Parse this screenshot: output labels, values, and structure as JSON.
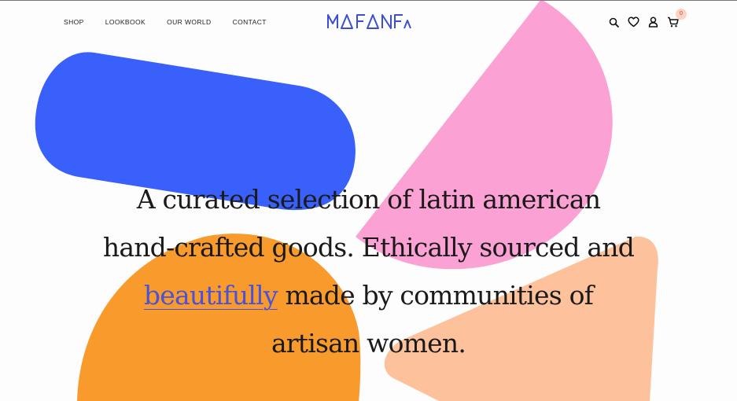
{
  "nav": {
    "items": [
      {
        "label": "SHOP"
      },
      {
        "label": "LOOKBOOK"
      },
      {
        "label": "OUR WORLD"
      },
      {
        "label": "CONTACT"
      }
    ]
  },
  "brand": {
    "name": "MAFANFA",
    "color": "#3b4fd6"
  },
  "header_icons": {
    "search": "search-icon",
    "wishlist": "heart-icon",
    "account": "user-icon",
    "cart": "cart-icon",
    "cart_count": "0"
  },
  "hero": {
    "text_before": "A curated selection of latin american hand-crafted goods. Ethically sourced and ",
    "link_text": "beautifully",
    "text_after": " made by communities of artisan women."
  },
  "colors": {
    "blue_shape": "#3a60fb",
    "pink_shape": "#fba1d4",
    "orange_shape": "#f99b2c",
    "peach_shape": "#fdc29c",
    "link": "#4a52d6"
  }
}
